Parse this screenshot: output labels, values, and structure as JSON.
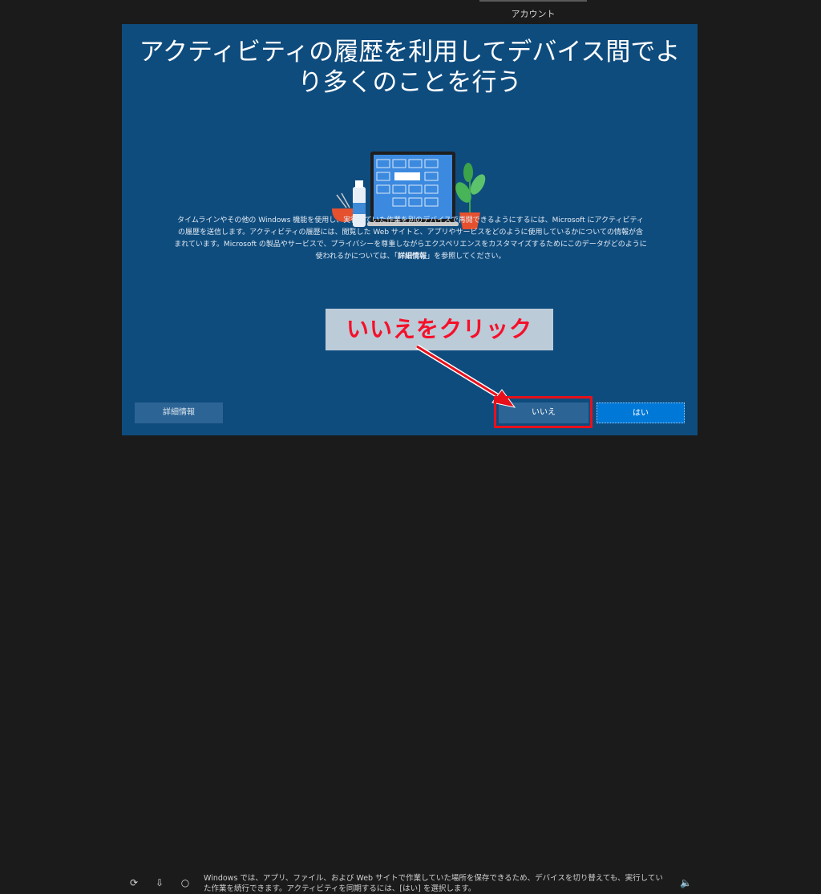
{
  "top_tab": {
    "label": "アカウント"
  },
  "panel": {
    "title": "アクティビティの履歴を利用してデバイス間でより多くのことを行う",
    "body_lines": [
      "タイムラインやその他の Windows 機能を使用し、実行していた作業を別のデバイスで再開できるようにするには、Microsoft にアクティビティ",
      "の履歴を送信します。アクティビティの履歴には、閲覧した Web サイトと、アプリやサービスをどのように使用しているかについての情報が含",
      "まれています。Microsoft の製品やサービスで、プライバシーを尊重しながらエクスペリエンスをカスタマイズするためにこのデータがどのように"
    ],
    "body_last_pre": "使われるかについては、「",
    "body_last_bold": "詳細情報",
    "body_last_post": "」を参照してください。"
  },
  "buttons": {
    "details": "詳細情報",
    "no": "いいえ",
    "yes": "はい"
  },
  "annotation": {
    "callout": "いいえをクリック",
    "highlight_color": "#e8101b"
  },
  "footer": {
    "text": "Windows では、アプリ、ファイル、および Web サイトで作業していた場所を保存できるため、デバイスを切り替えても、実行していた作業を続行できます。アクティビティを同期するには、[はい] を選択します。"
  },
  "bottom_icons": [
    "accessibility-icon",
    "download-icon",
    "cortana-circle-icon",
    "volume-icon"
  ]
}
